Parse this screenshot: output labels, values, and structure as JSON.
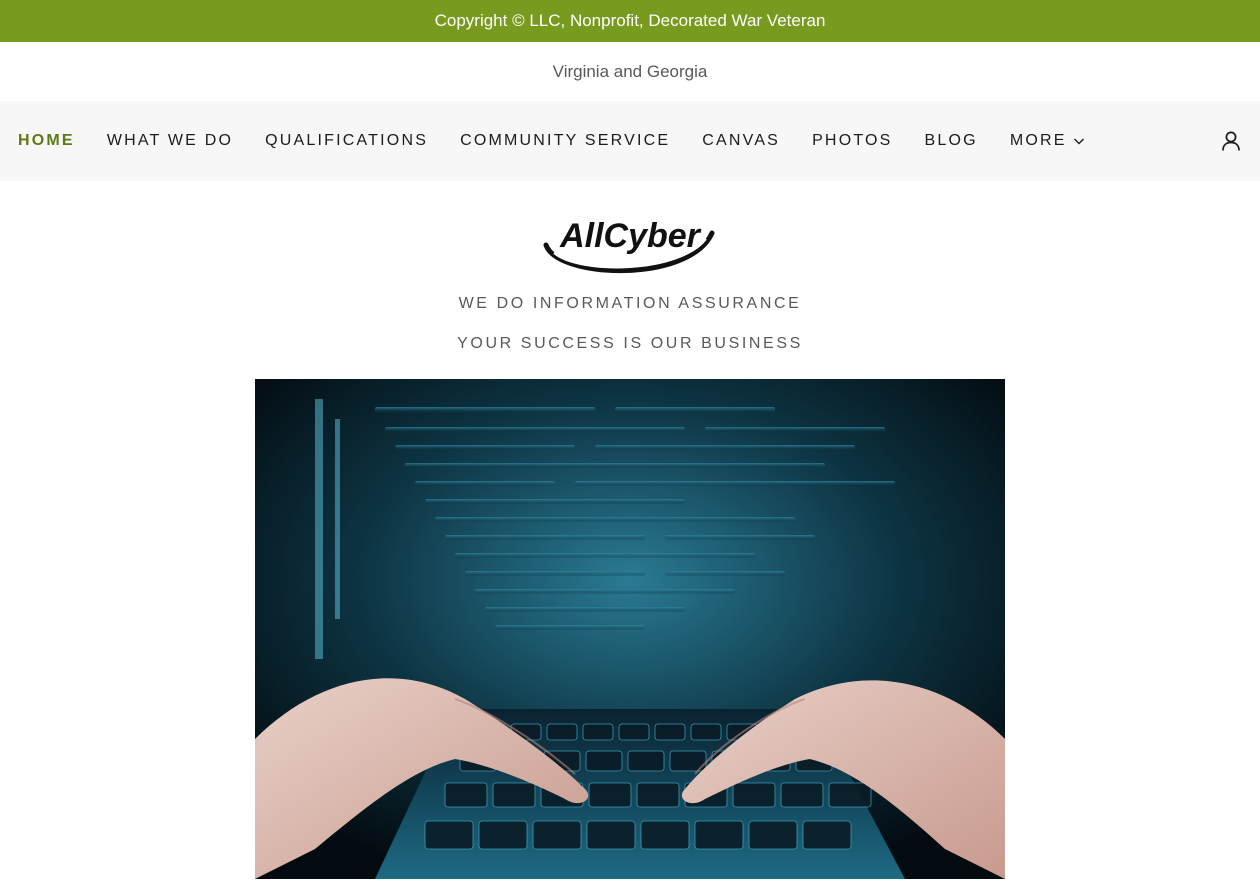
{
  "announcement": {
    "text": "Copyright © LLC, Nonprofit, Decorated War Veteran",
    "background": "#789a1e"
  },
  "location": {
    "text": "Virginia and Georgia"
  },
  "nav": {
    "items": [
      {
        "label": "HOME",
        "active": true
      },
      {
        "label": "WHAT WE DO"
      },
      {
        "label": "QUALIFICATIONS"
      },
      {
        "label": "COMMUNITY SERVICE"
      },
      {
        "label": "CANVAS"
      },
      {
        "label": "PHOTOS"
      },
      {
        "label": "BLOG"
      },
      {
        "label": "MORE"
      }
    ],
    "active_color": "#5e7a14",
    "more_icon": "chevron-down-icon",
    "account_icon": "user-icon"
  },
  "hero": {
    "logo_text": "AllCyber",
    "tagline": "WE DO INFORMATION ASSURANCE",
    "subtagline": "YOUR SUCCESS IS OUR BUSINESS",
    "image_subject": "hands-typing-on-laptop-with-code-on-screen"
  }
}
